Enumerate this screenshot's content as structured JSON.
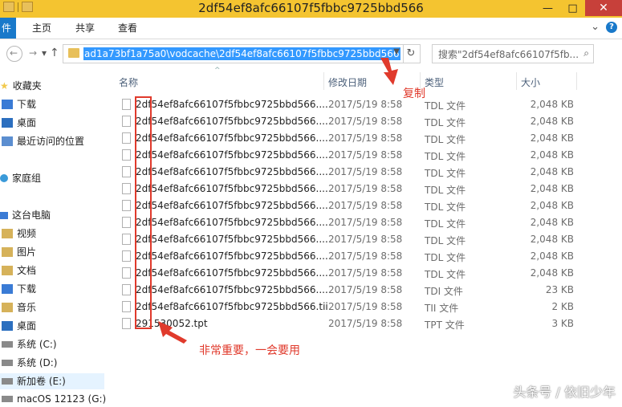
{
  "window": {
    "title": "2df54ef8afc66107f5fbbc9725bbd566",
    "buttons": {
      "minimize": "—",
      "maximize": "□",
      "close": "✕"
    }
  },
  "ribbon": {
    "file_tab": "件",
    "tabs": [
      "主页",
      "共享",
      "查看"
    ],
    "expand_icon": "⌄",
    "help_icon": "?"
  },
  "address_bar": {
    "path": "ad1a73bf1a75a0\\vodcache\\2df54ef8afc66107f5fbbc9725bbd566",
    "search_placeholder": "搜索\"2df54ef8afc66107f5fb...",
    "back_icon": "←",
    "forward_icon": "→",
    "up_icon": "↑",
    "recent_icon": "▾",
    "refresh_icon": "↻",
    "search_icon": "⌕"
  },
  "sidebar": {
    "items": [
      {
        "label": "收藏夹",
        "icon": "star-icon",
        "color": "#f2c94c"
      },
      {
        "label": "下载",
        "icon": "download-folder-icon",
        "color": "#3a7bd5"
      },
      {
        "label": "桌面",
        "icon": "desktop-icon",
        "color": "#2c6fbf"
      },
      {
        "label": "最近访问的位置",
        "icon": "recent-places-icon",
        "color": "#5b8ed0"
      },
      {
        "label": "家庭组",
        "icon": "homegroup-icon",
        "color": "#3a9ad9"
      },
      {
        "label": "这台电脑",
        "icon": "computer-icon",
        "color": "#3a7bd5"
      },
      {
        "label": "视频",
        "icon": "videos-folder-icon",
        "color": "#d6b25a"
      },
      {
        "label": "图片",
        "icon": "pictures-folder-icon",
        "color": "#d6b25a"
      },
      {
        "label": "文档",
        "icon": "documents-folder-icon",
        "color": "#d6b25a"
      },
      {
        "label": "下载",
        "icon": "downloads-folder-icon",
        "color": "#3a7bd5"
      },
      {
        "label": "音乐",
        "icon": "music-folder-icon",
        "color": "#d6b25a"
      },
      {
        "label": "桌面",
        "icon": "desktop-folder-icon",
        "color": "#2c6fbf"
      },
      {
        "label": "系统 (C:)",
        "icon": "drive-icon",
        "color": "#8a8a8a"
      },
      {
        "label": "系统 (D:)",
        "icon": "drive-icon",
        "color": "#8a8a8a"
      },
      {
        "label": "新加卷 (E:)",
        "icon": "drive-icon",
        "color": "#8a8a8a"
      },
      {
        "label": "macOS 12123 (G:)",
        "icon": "drive-icon",
        "color": "#8a8a8a"
      }
    ]
  },
  "columns": {
    "name": "名称",
    "modified": "修改日期",
    "type": "类型",
    "size": "大小"
  },
  "files": [
    {
      "name": "2df54ef8afc66107f5fbbc9725bbd566....",
      "modified": "2017/5/19 8:58",
      "type": "TDL 文件",
      "size": "2,048 KB"
    },
    {
      "name": "2df54ef8afc66107f5fbbc9725bbd566....",
      "modified": "2017/5/19 8:58",
      "type": "TDL 文件",
      "size": "2,048 KB"
    },
    {
      "name": "2df54ef8afc66107f5fbbc9725bbd566....",
      "modified": "2017/5/19 8:58",
      "type": "TDL 文件",
      "size": "2,048 KB"
    },
    {
      "name": "2df54ef8afc66107f5fbbc9725bbd566....",
      "modified": "2017/5/19 8:58",
      "type": "TDL 文件",
      "size": "2,048 KB"
    },
    {
      "name": "2df54ef8afc66107f5fbbc9725bbd566....",
      "modified": "2017/5/19 8:58",
      "type": "TDL 文件",
      "size": "2,048 KB"
    },
    {
      "name": "2df54ef8afc66107f5fbbc9725bbd566....",
      "modified": "2017/5/19 8:58",
      "type": "TDL 文件",
      "size": "2,048 KB"
    },
    {
      "name": "2df54ef8afc66107f5fbbc9725bbd566....",
      "modified": "2017/5/19 8:58",
      "type": "TDL 文件",
      "size": "2,048 KB"
    },
    {
      "name": "2df54ef8afc66107f5fbbc9725bbd566....",
      "modified": "2017/5/19 8:58",
      "type": "TDL 文件",
      "size": "2,048 KB"
    },
    {
      "name": "2df54ef8afc66107f5fbbc9725bbd566....",
      "modified": "2017/5/19 8:58",
      "type": "TDL 文件",
      "size": "2,048 KB"
    },
    {
      "name": "2df54ef8afc66107f5fbbc9725bbd566....",
      "modified": "2017/5/19 8:58",
      "type": "TDL 文件",
      "size": "2,048 KB"
    },
    {
      "name": "2df54ef8afc66107f5fbbc9725bbd566....",
      "modified": "2017/5/19 8:58",
      "type": "TDL 文件",
      "size": "2,048 KB"
    },
    {
      "name": "2df54ef8afc66107f5fbbc9725bbd566....",
      "modified": "2017/5/19 8:58",
      "type": "TDI 文件",
      "size": "23 KB"
    },
    {
      "name": "2df54ef8afc66107f5fbbc9725bbd566.tii",
      "modified": "2017/5/19 8:58",
      "type": "TII 文件",
      "size": "2 KB"
    },
    {
      "name": "291530052.tpt",
      "modified": "2017/5/19 8:58",
      "type": "TPT 文件",
      "size": "3 KB"
    }
  ],
  "annotations": {
    "copy": "复制",
    "important": "非常重要，一会要用",
    "color": "#e03a2c"
  },
  "watermark": "头条号 / 依旧少年"
}
